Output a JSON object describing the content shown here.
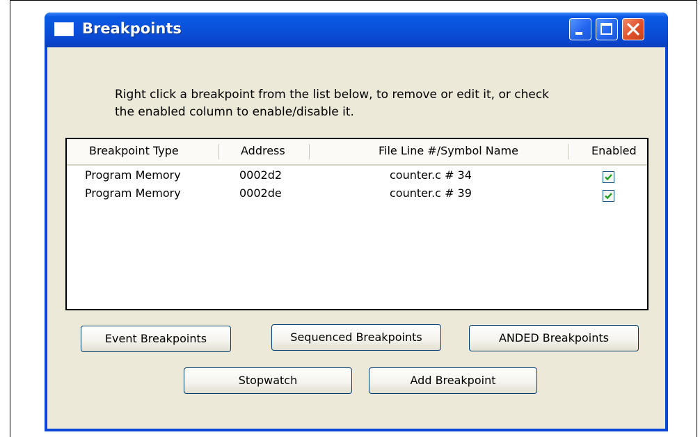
{
  "window": {
    "title": "Breakpoints",
    "title_icon": "window-icon",
    "controls": [
      "minimize-icon",
      "maximize-icon",
      "close-icon"
    ]
  },
  "instructions": {
    "line1": "Right click a breakpoint from the list below, to remove or edit it, or check",
    "line2": "the enabled column to enable/disable it."
  },
  "list": {
    "columns": [
      "Breakpoint Type",
      "Address",
      "File Line #/Symbol Name",
      "Enabled"
    ],
    "rows": [
      {
        "type": "Program Memory",
        "address": "0002d2",
        "location": "counter.c # 34",
        "enabled": true
      },
      {
        "type": "Program Memory",
        "address": "0002de",
        "location": "counter.c # 39",
        "enabled": true
      }
    ]
  },
  "buttons": {
    "event": "Event Breakpoints",
    "sequenced": "Sequenced Breakpoints",
    "anded": "ANDED Breakpoints",
    "stopwatch": "Stopwatch",
    "add": "Add Breakpoint"
  },
  "colors": {
    "titlebar": "#0a4fd8",
    "dialog_bg": "#ece9d8",
    "check_mark": "#21a121",
    "close_button": "#e0512b"
  }
}
